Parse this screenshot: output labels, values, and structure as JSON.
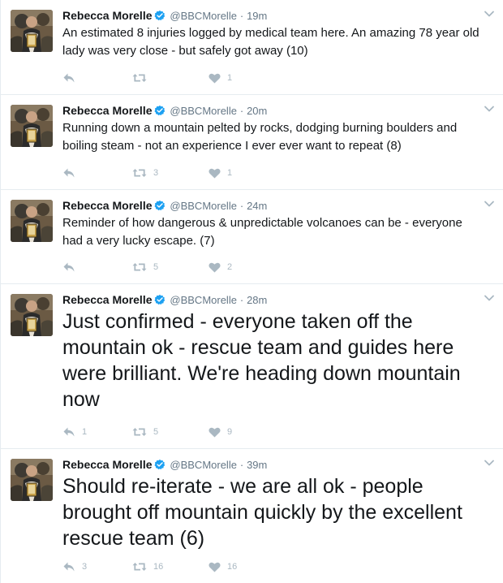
{
  "author": {
    "name": "Rebecca Morelle",
    "handle": "@BBCMorelle",
    "dot": "·"
  },
  "colors": {
    "verified": "#1da1f2",
    "muted": "#aab8c2",
    "secondary": "#657786"
  },
  "tweets": [
    {
      "time": "19m",
      "text": "An estimated 8 injuries logged by medical team here. An amazing 78 year old lady was very close - but safely got away (10)",
      "replies": "",
      "retweets": "",
      "likes": "1"
    },
    {
      "time": "20m",
      "text": "Running down a mountain pelted by rocks, dodging burning boulders and boiling steam - not an experience I ever ever want to repeat (8)",
      "replies": "",
      "retweets": "3",
      "likes": "1"
    },
    {
      "time": "24m",
      "text": "Reminder of how dangerous & unpredictable volcanoes can be - everyone had a very lucky escape. (7)",
      "replies": "",
      "retweets": "5",
      "likes": "2"
    },
    {
      "time": "28m",
      "text": "Just confirmed - everyone taken off the mountain ok - rescue team and guides here were brilliant. We're heading down mountain now",
      "replies": "1",
      "retweets": "5",
      "likes": "9"
    },
    {
      "time": "39m",
      "text": "Should re-iterate - we are all ok - people brought off mountain quickly by the excellent rescue team (6)",
      "replies": "3",
      "retweets": "16",
      "likes": "16"
    }
  ]
}
